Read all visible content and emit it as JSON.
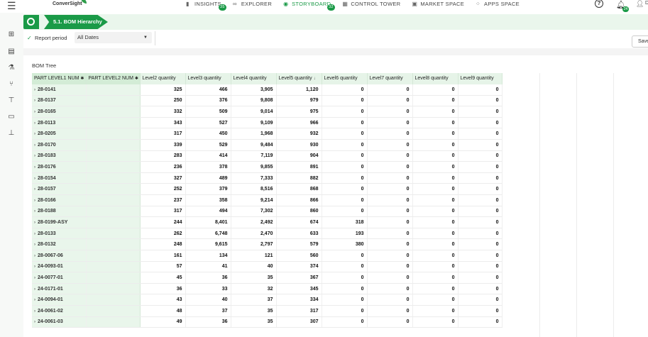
{
  "app": {
    "brand": "ConverSight",
    "user_initial": "D"
  },
  "nav": [
    {
      "label": "INSIGHTS",
      "icon": "bar-chart-icon",
      "badge": "35",
      "active": false
    },
    {
      "label": "EXPLORER",
      "icon": "binoculars-icon",
      "badge": "",
      "active": false
    },
    {
      "label": "STORYBOARD",
      "icon": "storyboard-icon",
      "badge": "32",
      "active": true
    },
    {
      "label": "CONTROL TOWER",
      "icon": "tower-icon",
      "badge": "",
      "active": false
    },
    {
      "label": "MARKET SPACE",
      "icon": "store-icon",
      "badge": "",
      "active": false
    },
    {
      "label": "APPS SPACE",
      "icon": "apps-icon",
      "badge": "",
      "active": false
    }
  ],
  "notifications": {
    "badge": "24"
  },
  "story": {
    "tab_label": "5.1. BOM Hierarchy"
  },
  "filter": {
    "label": "Report period",
    "value": "All Dates"
  },
  "toolbar": {
    "save_label": "Save"
  },
  "section": {
    "title": "BOM Tree"
  },
  "table": {
    "columns": [
      "PART LEVEL1 NUM",
      "PART LEVEL2 NUM",
      "Level2 quantity",
      "Level3 quantity",
      "Level4 quantity",
      "Level5 quantity",
      "Level6 quantity",
      "Level7 quantity",
      "Level8 quantity",
      "Level9 quantity"
    ],
    "rows": [
      [
        "28-0141",
        "",
        "325",
        "466",
        "3,905",
        "1,120",
        "0",
        "0",
        "0",
        "0"
      ],
      [
        "28-0137",
        "",
        "250",
        "376",
        "9,808",
        "979",
        "0",
        "0",
        "0",
        "0"
      ],
      [
        "28-0165",
        "",
        "332",
        "509",
        "9,014",
        "975",
        "0",
        "0",
        "0",
        "0"
      ],
      [
        "28-0113",
        "",
        "343",
        "527",
        "9,109",
        "966",
        "0",
        "0",
        "0",
        "0"
      ],
      [
        "28-0205",
        "",
        "317",
        "450",
        "1,968",
        "932",
        "0",
        "0",
        "0",
        "0"
      ],
      [
        "28-0170",
        "",
        "339",
        "529",
        "9,484",
        "930",
        "0",
        "0",
        "0",
        "0"
      ],
      [
        "28-0183",
        "",
        "283",
        "414",
        "7,119",
        "904",
        "0",
        "0",
        "0",
        "0"
      ],
      [
        "28-0176",
        "",
        "236",
        "378",
        "9,855",
        "891",
        "0",
        "0",
        "0",
        "0"
      ],
      [
        "28-0154",
        "",
        "327",
        "489",
        "7,333",
        "882",
        "0",
        "0",
        "0",
        "0"
      ],
      [
        "28-0157",
        "",
        "252",
        "379",
        "8,516",
        "868",
        "0",
        "0",
        "0",
        "0"
      ],
      [
        "28-0166",
        "",
        "237",
        "358",
        "9,214",
        "866",
        "0",
        "0",
        "0",
        "0"
      ],
      [
        "28-0188",
        "",
        "317",
        "494",
        "7,302",
        "860",
        "0",
        "0",
        "0",
        "0"
      ],
      [
        "28-0199-ASY",
        "",
        "244",
        "8,401",
        "2,492",
        "674",
        "318",
        "0",
        "0",
        "0"
      ],
      [
        "28-0133",
        "",
        "262",
        "6,748",
        "2,470",
        "633",
        "193",
        "0",
        "0",
        "0"
      ],
      [
        "28-0132",
        "",
        "248",
        "9,615",
        "2,797",
        "579",
        "380",
        "0",
        "0",
        "0"
      ],
      [
        "28-0067-06",
        "",
        "161",
        "134",
        "121",
        "560",
        "0",
        "0",
        "0",
        "0"
      ],
      [
        "24-0093-01",
        "",
        "57",
        "41",
        "40",
        "374",
        "0",
        "0",
        "0",
        "0"
      ],
      [
        "24-0077-01",
        "",
        "45",
        "36",
        "35",
        "367",
        "0",
        "0",
        "0",
        "0"
      ],
      [
        "24-0171-01",
        "",
        "36",
        "33",
        "32",
        "345",
        "0",
        "0",
        "0",
        "0"
      ],
      [
        "24-0094-01",
        "",
        "43",
        "40",
        "37",
        "334",
        "0",
        "0",
        "0",
        "0"
      ],
      [
        "24-0061-02",
        "",
        "48",
        "37",
        "35",
        "317",
        "0",
        "0",
        "0",
        "0"
      ],
      [
        "24-0061-03",
        "",
        "49",
        "36",
        "35",
        "307",
        "0",
        "0",
        "0",
        "0"
      ]
    ]
  }
}
